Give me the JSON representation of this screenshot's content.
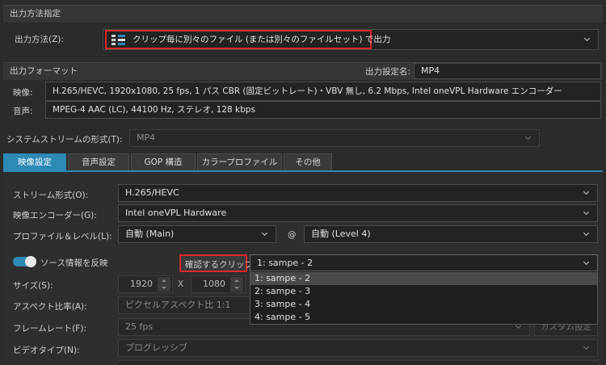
{
  "output_method": {
    "section_title": "出力方法指定",
    "label": "出力方法(Z):",
    "value": "クリップ毎に別々のファイル (または別々のファイルセット) で出力",
    "icon": "clips-to-files-icon"
  },
  "output_format": {
    "section_title": "出力フォーマット",
    "settings_name_label": "出力設定名:",
    "settings_name_value": "MP4",
    "video_label": "映像:",
    "video_value": "H.265/HEVC, 1920x1080, 25 fps, 1 パス CBR (固定ビットレート)・VBV 無し, 6.2 Mbps, Intel oneVPL Hardware エンコーダー",
    "audio_label": "音声:",
    "audio_value": "MPEG-4 AAC (LC), 44100 Hz, ステレオ, 128 kbps"
  },
  "system_stream": {
    "label": "システムストリームの形式(T):",
    "value": "MP4"
  },
  "tabs": [
    {
      "label": "映像設定",
      "active": true
    },
    {
      "label": "音声設定",
      "active": false
    },
    {
      "label": "GOP 構造",
      "active": false
    },
    {
      "label": "カラープロファイル",
      "active": false
    },
    {
      "label": "その他",
      "active": false
    }
  ],
  "video_settings": {
    "stream_format_label": "ストリーム形式(O):",
    "stream_format_value": "H.265/HEVC",
    "encoder_label": "映像エンコーダー(G):",
    "encoder_value": "Intel oneVPL Hardware",
    "profile_label": "プロファイル＆レベル(L):",
    "profile_value": "自動 (Main)",
    "at_sign": "@",
    "level_value": "自動 (Level 4)",
    "reflect_source_label": "ソース情報を反映",
    "reflect_source_on": true,
    "confirm_clip_label": "確認するクリップ:",
    "confirm_clip_value": "1: sampe - 2",
    "clip_options": [
      "1: sampe - 2",
      "2: sampe - 3",
      "3: sampe - 4",
      "4: sampe - 5"
    ],
    "size_label": "サイズ(S):",
    "width_value": "1920",
    "times": "X",
    "height_value": "1080",
    "aspect_label": "アスペクト比率(A):",
    "aspect_value": "ピクセルアスペクト比 1:1",
    "framerate_label": "フレームレート(F):",
    "framerate_value": "25 fps",
    "custom_button": "カスタム設定",
    "videotype_label": "ビデオタイプ(N):",
    "videotype_value": "プログレッシブ"
  },
  "colors": {
    "accent": "#2d8ab5",
    "highlight_box": "#e0262b",
    "background": "#2b2b2b"
  }
}
